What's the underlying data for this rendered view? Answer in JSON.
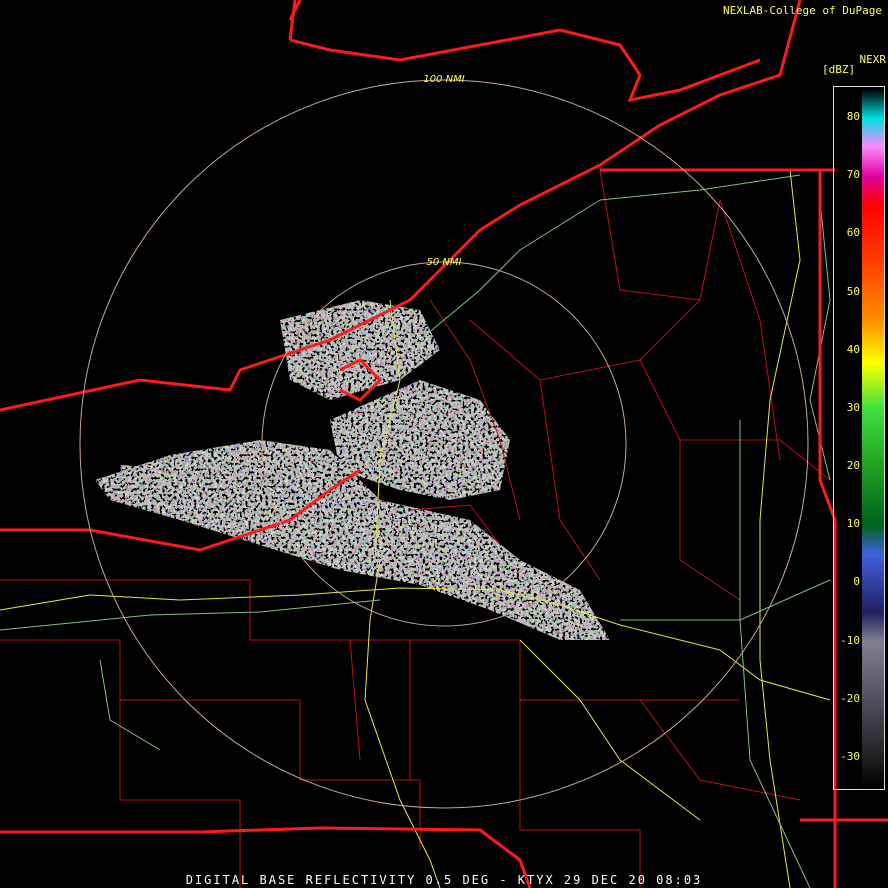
{
  "header": {
    "credit": "NEXLAB-College of DuPage",
    "product": "DIGITAL BASE REFLECTIVITY 0.5 DEG - KTYX 29 DEC 20 08:03"
  },
  "range_rings": {
    "outer_label": "100 NMI",
    "inner_label": "50 NMI"
  },
  "legend": {
    "title": "NEXR",
    "units": "[dBZ]",
    "ticks": [
      "80",
      "70",
      "60",
      "50",
      "40",
      "30",
      "20",
      "10",
      "0",
      "-10",
      "-20",
      "-30"
    ],
    "color_stops": [
      {
        "dbz": 80,
        "color": "#00e0e0"
      },
      {
        "dbz": 75,
        "color": "#ff88ff"
      },
      {
        "dbz": 70,
        "color": "#e000a0"
      },
      {
        "dbz": 65,
        "color": "#ff0000"
      },
      {
        "dbz": 55,
        "color": "#ff4000"
      },
      {
        "dbz": 45,
        "color": "#ff9000"
      },
      {
        "dbz": 38,
        "color": "#ffff00"
      },
      {
        "dbz": 30,
        "color": "#40e040"
      },
      {
        "dbz": 20,
        "color": "#20a020"
      },
      {
        "dbz": 10,
        "color": "#006020"
      },
      {
        "dbz": 5,
        "color": "#4060e0"
      },
      {
        "dbz": 0,
        "color": "#3040a0"
      },
      {
        "dbz": -5,
        "color": "#202060"
      },
      {
        "dbz": -10,
        "color": "#808090"
      },
      {
        "dbz": -20,
        "color": "#505060"
      },
      {
        "dbz": -30,
        "color": "#202020"
      }
    ]
  },
  "colors": {
    "state_border": "#ff1a1a",
    "county_border": "#c01010",
    "road_yellow": "#e8e840",
    "road_green": "#80c080",
    "ring": "#c8a890",
    "text": "#ffff55"
  }
}
